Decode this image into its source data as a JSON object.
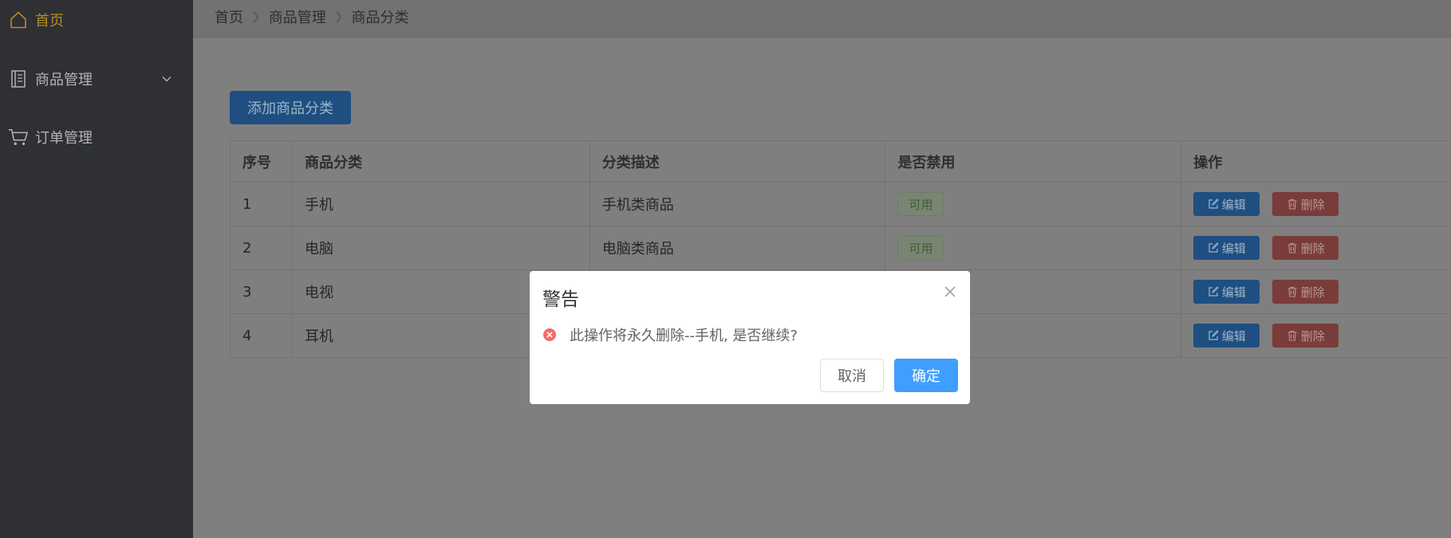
{
  "sidebar": {
    "items": [
      {
        "label": "首页",
        "icon": "home-icon"
      },
      {
        "label": "商品管理",
        "icon": "document-icon"
      },
      {
        "label": "订单管理",
        "icon": "cart-icon"
      }
    ]
  },
  "breadcrumb": [
    "首页",
    "商品管理",
    "商品分类"
  ],
  "toolbar": {
    "add_label": "添加商品分类"
  },
  "table": {
    "headers": [
      "序号",
      "商品分类",
      "分类描述",
      "是否禁用",
      "操作"
    ],
    "rows": [
      {
        "index": "1",
        "name": "手机",
        "desc": "手机类商品",
        "status": "可用"
      },
      {
        "index": "2",
        "name": "电脑",
        "desc": "电脑类商品",
        "status": "可用"
      },
      {
        "index": "3",
        "name": "电视",
        "desc": "",
        "status": ""
      },
      {
        "index": "4",
        "name": "耳机",
        "desc": "",
        "status": ""
      }
    ],
    "edit_label": "编辑",
    "delete_label": "删除"
  },
  "dialog": {
    "title": "警告",
    "message": "此操作将永久删除--手机, 是否继续?",
    "cancel_label": "取消",
    "confirm_label": "确定"
  },
  "colors": {
    "sidebar_bg": "#2e3034",
    "active_text": "#b68b1f",
    "primary": "#409eff",
    "danger": "#f56c6c"
  }
}
